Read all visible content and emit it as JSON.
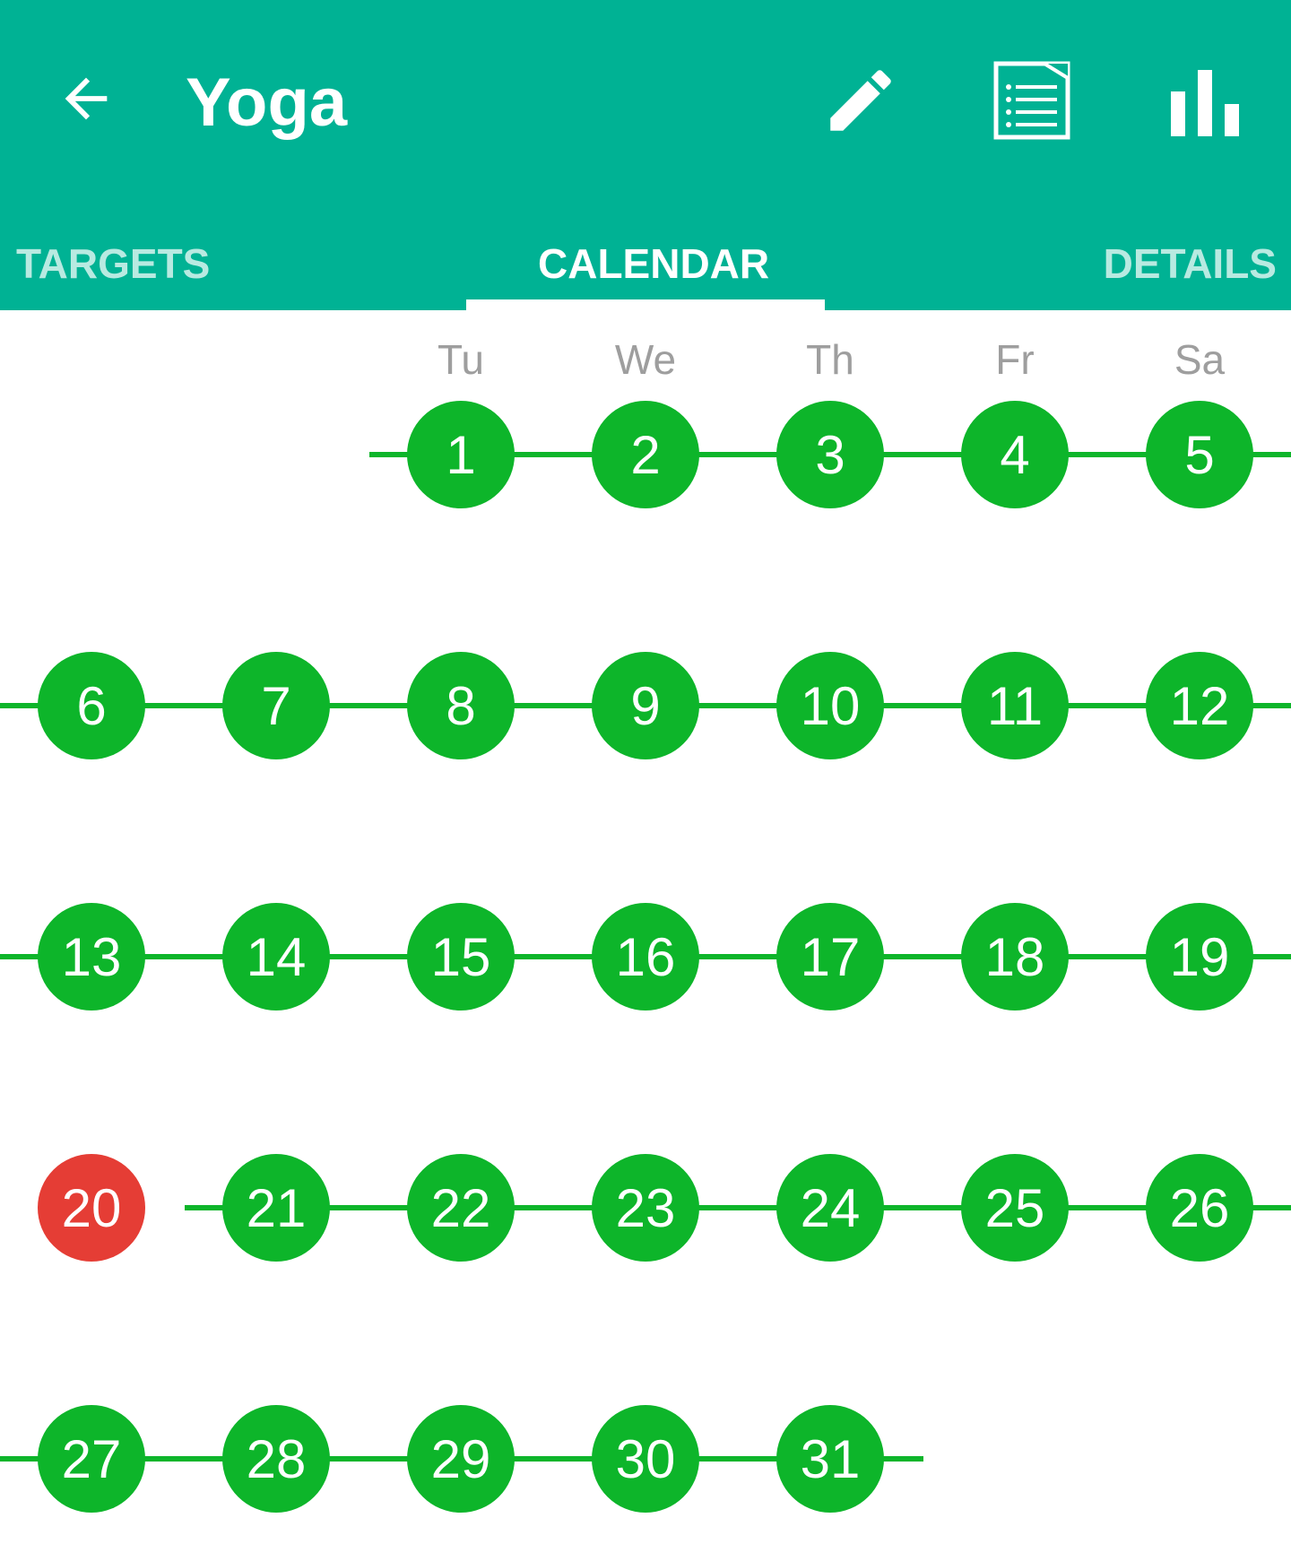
{
  "app_bar": {
    "title": "Yoga",
    "background": "#00b294",
    "icons": [
      "arrow-back-icon",
      "edit-pencil-icon",
      "list-document-icon",
      "bar-chart-icon"
    ]
  },
  "tabs": [
    {
      "label": "TARGETS",
      "active": false
    },
    {
      "label": "CALENDAR",
      "active": true
    },
    {
      "label": "DETAILS",
      "active": false
    }
  ],
  "calendar": {
    "weekday_headers": [
      "Tu",
      "We",
      "Th",
      "Fr",
      "Sa"
    ],
    "colors": {
      "completed": "#0db52a",
      "missed": "#e53d35"
    },
    "weeks": [
      [
        {
          "day": "1",
          "status": "completed"
        },
        {
          "day": "2",
          "status": "completed"
        },
        {
          "day": "3",
          "status": "completed"
        },
        {
          "day": "4",
          "status": "completed"
        },
        {
          "day": "5",
          "status": "completed"
        }
      ],
      [
        {
          "day": "6",
          "status": "completed"
        },
        {
          "day": "7",
          "status": "completed"
        },
        {
          "day": "8",
          "status": "completed"
        },
        {
          "day": "9",
          "status": "completed"
        },
        {
          "day": "10",
          "status": "completed"
        },
        {
          "day": "11",
          "status": "completed"
        },
        {
          "day": "12",
          "status": "completed"
        }
      ],
      [
        {
          "day": "13",
          "status": "completed"
        },
        {
          "day": "14",
          "status": "completed"
        },
        {
          "day": "15",
          "status": "completed"
        },
        {
          "day": "16",
          "status": "completed"
        },
        {
          "day": "17",
          "status": "completed"
        },
        {
          "day": "18",
          "status": "completed"
        },
        {
          "day": "19",
          "status": "completed"
        }
      ],
      [
        {
          "day": "20",
          "status": "missed"
        },
        {
          "day": "21",
          "status": "completed"
        },
        {
          "day": "22",
          "status": "completed"
        },
        {
          "day": "23",
          "status": "completed"
        },
        {
          "day": "24",
          "status": "completed"
        },
        {
          "day": "25",
          "status": "completed"
        },
        {
          "day": "26",
          "status": "completed"
        }
      ],
      [
        {
          "day": "27",
          "status": "completed"
        },
        {
          "day": "28",
          "status": "completed"
        },
        {
          "day": "29",
          "status": "completed"
        },
        {
          "day": "30",
          "status": "completed"
        },
        {
          "day": "31",
          "status": "completed"
        }
      ]
    ]
  }
}
